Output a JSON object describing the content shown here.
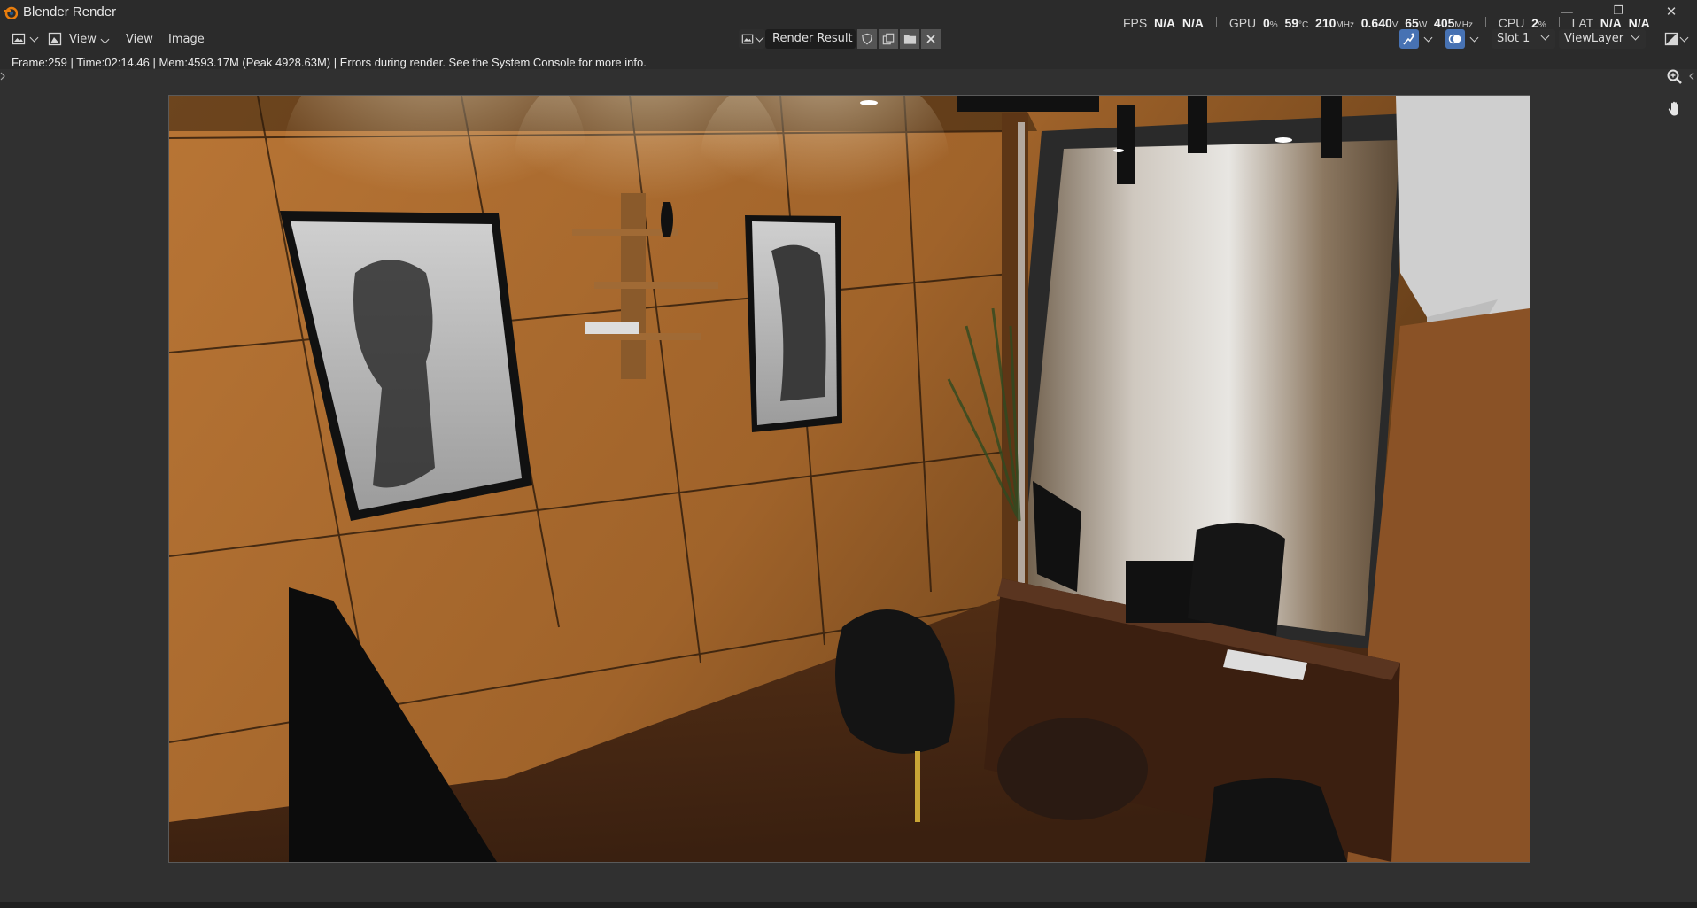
{
  "window": {
    "title": "Blender Render",
    "controls": {
      "minimize": "—",
      "maximize": "❐",
      "close": "✕"
    }
  },
  "stats": {
    "fps_label": "FPS",
    "fps_value_1": "N/A",
    "fps_value_2": "N/A",
    "gpu_label": "GPU",
    "gpu_usage": "0",
    "gpu_usage_unit": "%",
    "gpu_temp": "59",
    "gpu_temp_unit": "°C",
    "gpu_clock": "210",
    "gpu_clock_unit": "MHz",
    "gpu_voltage": "0.640",
    "gpu_voltage_unit": "V",
    "gpu_power": "65",
    "gpu_power_unit": "W",
    "gpu_mem_clock": "405",
    "gpu_mem_clock_unit": "MHz",
    "cpu_label": "CPU",
    "cpu_usage": "2",
    "cpu_usage_unit": "%",
    "lat_label": "LAT",
    "lat_value_1": "N/A",
    "lat_value_2": "N/A"
  },
  "header": {
    "menus": {
      "view_dropdown": "View",
      "view": "View",
      "image": "Image"
    },
    "image_name": "Render Result",
    "slot": "Slot 1",
    "view_layer": "ViewLayer"
  },
  "status_line": "Frame:259 | Time:02:14.46 | Mem:4593.17M (Peak 4928.63M) | Errors during render. See the System Console for more info.",
  "icons": {
    "editor_type": "image-editor-icon",
    "mode": "image-mode-icon",
    "browse": "image-browse-icon",
    "fake_user": "shield-icon",
    "new_image": "duplicate-icon",
    "open": "folder-icon",
    "unlink": "close-icon",
    "zoom": "zoom-icon",
    "pan": "hand-icon"
  },
  "colors": {
    "accent": "#4772b3",
    "background": "#2b2b2b",
    "viewport": "#303030"
  }
}
